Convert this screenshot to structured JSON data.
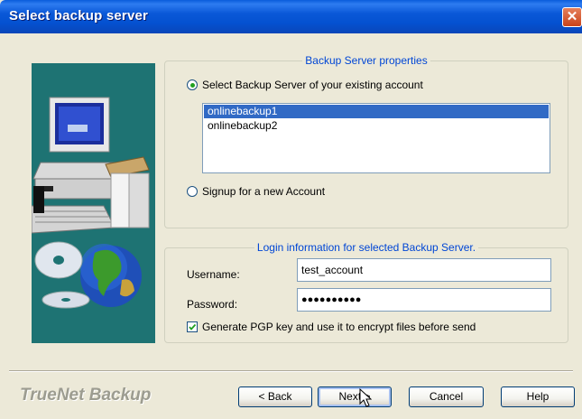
{
  "window": {
    "title": "Select backup server"
  },
  "server_group": {
    "legend": "Backup Server properties",
    "option_existing": "Select Backup Server of your existing account",
    "servers": [
      "onlinebackup1",
      "onlinebackup2"
    ],
    "selected_server": "onlinebackup1",
    "option_signup": "Signup for a new Account"
  },
  "login_group": {
    "legend": "Login information for selected Backup Server.",
    "username_label": "Username:",
    "username_value": "test_account",
    "password_label": "Password:",
    "password_value": "●●●●●●●●●●",
    "pgp_label": "Generate PGP key and use it to encrypt files before send",
    "pgp_checked": true
  },
  "footer": {
    "brand": "TrueNet Backup",
    "back_label": "< Back",
    "next_label": "Next >",
    "cancel_label": "Cancel",
    "help_label": "Help"
  },
  "colors": {
    "title_bar": "#0A58D8",
    "art_background": "#1E7373",
    "legend_text": "#0046D5",
    "selection": "#316AC5"
  }
}
